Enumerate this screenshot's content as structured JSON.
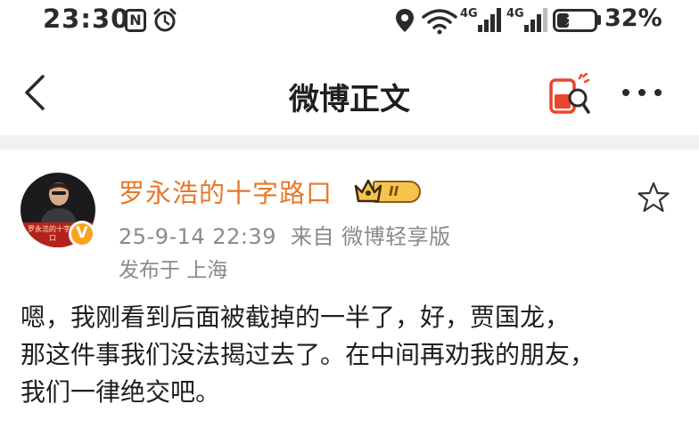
{
  "status_bar": {
    "time": "23:30",
    "nfc_label": "N",
    "network_1": "4G",
    "network_2": "4G",
    "battery_percent": "32%",
    "battery_level": 0.32
  },
  "nav": {
    "title": "微博正文",
    "icons": [
      "back-arrow-icon",
      "red-packet-icon",
      "more-icon"
    ]
  },
  "post": {
    "username": "罗永浩的十字路口",
    "member_level": "II",
    "avatar_caption": "罗永浩的十字路口",
    "timestamp": "25-9-14 22:39",
    "source": "来自 微博轻享版",
    "location": "发布于 上海",
    "content_lines": [
      "嗯，我刚看到后面被截掉的一半了，好，贾国龙，",
      "那这件事我们没法揭过去了。在中间再劝我的朋友，",
      "我们一律绝交吧。"
    ]
  },
  "colors": {
    "username": "#e8772b",
    "meta": "#8a8a8a",
    "divider": "#f1f1f1",
    "verify_badge": "#f7a421",
    "red_packet": "#e8472b"
  }
}
